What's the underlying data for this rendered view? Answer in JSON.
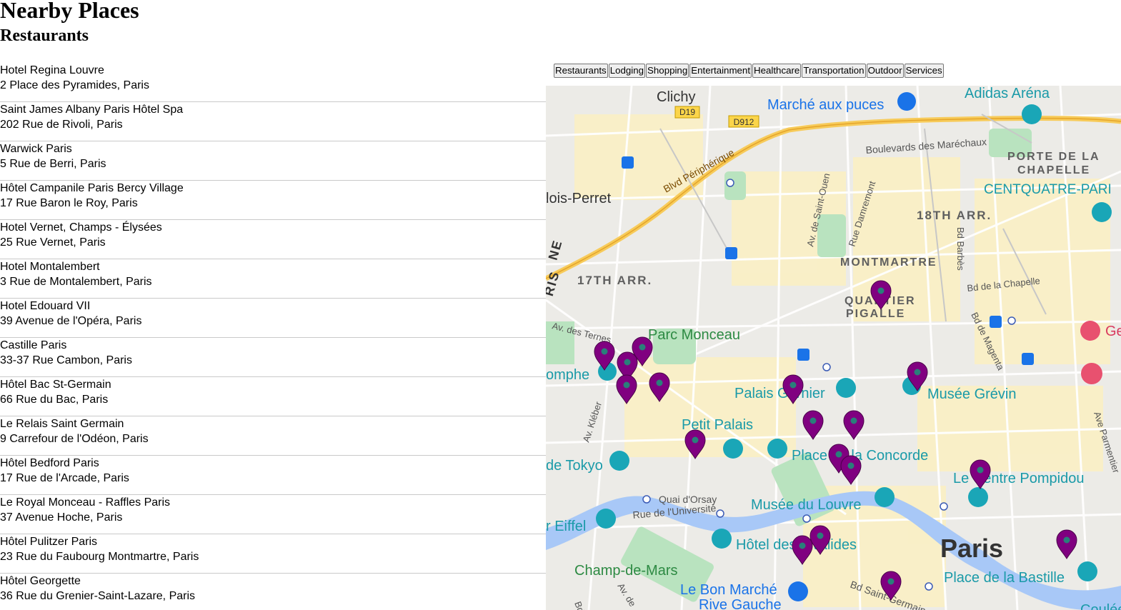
{
  "page": {
    "title": "Nearby Places",
    "category_heading": "Restaurants"
  },
  "places": [
    {
      "name": "Hotel Regina Louvre",
      "address": "2 Place des Pyramides, Paris"
    },
    {
      "name": "Saint James Albany Paris Hôtel Spa",
      "address": "202 Rue de Rivoli, Paris"
    },
    {
      "name": "Warwick Paris",
      "address": "5 Rue de Berri, Paris"
    },
    {
      "name": "Hôtel Campanile Paris Bercy Village",
      "address": "17 Rue Baron le Roy, Paris"
    },
    {
      "name": "Hotel Vernet, Champs - Élysées",
      "address": "25 Rue Vernet, Paris"
    },
    {
      "name": "Hotel Montalembert",
      "address": "3 Rue de Montalembert, Paris"
    },
    {
      "name": "Hotel Edouard VII",
      "address": "39 Avenue de l'Opéra, Paris"
    },
    {
      "name": "Castille Paris",
      "address": "33-37 Rue Cambon, Paris"
    },
    {
      "name": "Hôtel Bac St-Germain",
      "address": "66 Rue du Bac, Paris"
    },
    {
      "name": "Le Relais Saint Germain",
      "address": "9 Carrefour de l'Odéon, Paris"
    },
    {
      "name": "Hôtel Bedford Paris",
      "address": "17 Rue de l'Arcade, Paris"
    },
    {
      "name": "Le Royal Monceau - Raffles Paris",
      "address": "37 Avenue Hoche, Paris"
    },
    {
      "name": "Hôtel Pulitzer Paris",
      "address": "23 Rue du Faubourg Montmartre, Paris"
    },
    {
      "name": "Hôtel Georgette",
      "address": "36 Rue du Grenier-Saint-Lazare, Paris"
    }
  ],
  "tabs": [
    "Restaurants",
    "Lodging",
    "Shopping",
    "Entertainment",
    "Healthcare",
    "Transportation",
    "Outdoor",
    "Services"
  ],
  "map": {
    "colors": {
      "marker": "#800080",
      "marker_dot": "#2a7f7a",
      "water": "#a8c8f7",
      "park": "#b9e3bf",
      "highway": "#f7cb5a",
      "poi": "#1aa6b7"
    },
    "labels": {
      "clichy": "Clichy",
      "d19": "D19",
      "d912": "D912",
      "marche": "Marché aux puces",
      "adidas": "Adidas Aréna",
      "periph": "Blvd Périphérique",
      "marechaux": "Boulevards des Maréchaux",
      "porte1": "PORTE DE LA",
      "porte2": "CHAPELLE",
      "centquatre": "CENTQUATRE-PARI",
      "levallois": "lois-Perret",
      "saintouen": "Av. de Saint-Ouen",
      "damremont": "Rue Damremont",
      "arr18": "18TH ARR.",
      "montmartre": "MONTMARTRE",
      "barbes": "Bd Barbès",
      "chapelle": "Bd de la Chapelle",
      "arr17": "17TH ARR.",
      "quartier": "QUARTIER",
      "pigalle": "PIGALLE",
      "ternes": "Av. des Ternes",
      "monceau": "Parc Monceau",
      "ge": "Ge",
      "magenta": "Bd de Magenta",
      "omphe": "omphe",
      "garnier": "Palais Garnier",
      "grevin": "Musée Grévin",
      "kleber": "Av. Kléber",
      "petitpalais": "Petit Palais",
      "permentier": "Ave Parmentier",
      "concorde": "Place de la Concorde",
      "tokyo": "de Tokyo",
      "pompidou": "Le Centre Pompidou",
      "orsay": "Quai d'Orsay",
      "universite": "Rue de l'Université",
      "louvre": "Musée du Louvre",
      "eiffel": "r Eiffel",
      "invalides": "Hôtel des Invalides",
      "paris": "Paris",
      "champ": "Champ-de-Mars",
      "bastille": "Place de la Bastille",
      "bonmarche": "Le Bon Marché",
      "rivegauche": "Rive Gauche",
      "stgermain": "Bd Saint-Germain",
      "coulee": "Coulée v",
      "ne": "NE",
      "ris": "RIS",
      "bd": "Bd",
      "avde": "Av. de"
    }
  }
}
